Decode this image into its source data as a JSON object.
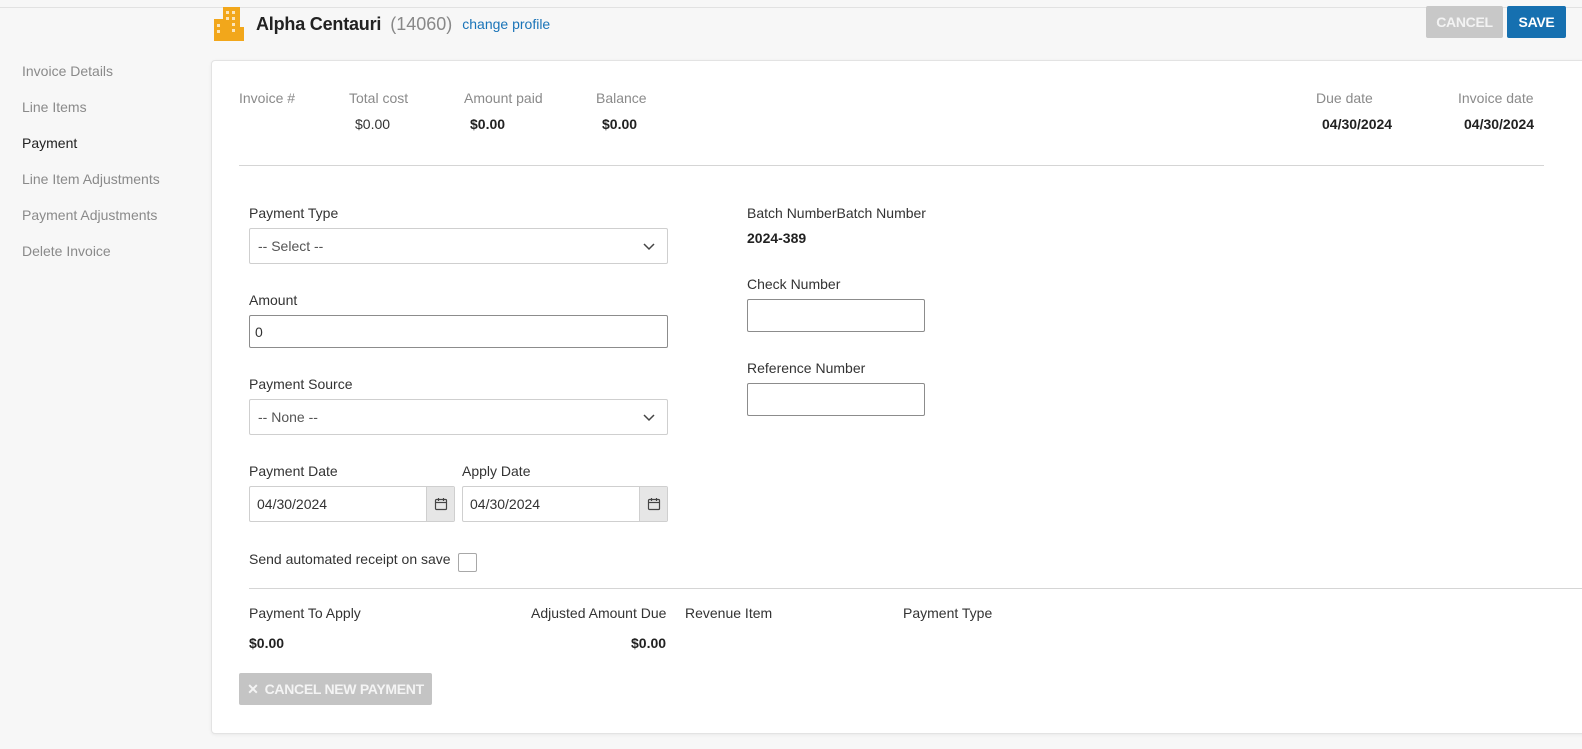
{
  "header": {
    "profile_name": "Alpha Centauri",
    "profile_id": "(14060)",
    "change_profile": "change profile",
    "cancel_label": "CANCEL",
    "save_label": "SAVE"
  },
  "sidebar": {
    "items": [
      {
        "label": "Invoice Details"
      },
      {
        "label": "Line Items"
      },
      {
        "label": "Payment"
      },
      {
        "label": "Line Item Adjustments"
      },
      {
        "label": "Payment Adjustments"
      },
      {
        "label": "Delete Invoice"
      }
    ],
    "active": "Payment"
  },
  "summary": {
    "invoice_label": "Invoice #",
    "invoice_value": "",
    "total_cost_label": "Total cost",
    "total_cost_value": "$0.00",
    "amount_paid_label": "Amount paid",
    "amount_paid_value": "$0.00",
    "balance_label": "Balance",
    "balance_value": "$0.00",
    "due_date_label": "Due date",
    "due_date_value": "04/30/2024",
    "invoice_date_label": "Invoice date",
    "invoice_date_value": "04/30/2024"
  },
  "form": {
    "payment_type_label": "Payment Type",
    "payment_type_value": "-- Select --",
    "amount_label": "Amount",
    "amount_value": "0",
    "payment_source_label": "Payment Source",
    "payment_source_value": "-- None --",
    "payment_date_label": "Payment Date",
    "payment_date_value": "04/30/2024",
    "apply_date_label": "Apply Date",
    "apply_date_value": "04/30/2024",
    "batch_label": "Batch NumberBatch Number",
    "batch_value": "2024-389",
    "check_label": "Check Number",
    "check_value": "",
    "reference_label": "Reference Number",
    "reference_value": "",
    "receipt_label": "Send automated receipt on save"
  },
  "apply": {
    "payment_to_apply_label": "Payment To Apply",
    "payment_to_apply_value": "$0.00",
    "adjusted_amount_label": "Adjusted Amount Due",
    "adjusted_amount_value": "$0.00",
    "revenue_item_label": "Revenue Item",
    "payment_type_label": "Payment Type",
    "cancel_new_payment": "CANCEL NEW PAYMENT"
  },
  "colors": {
    "accent": "#1670b0",
    "logo": "#f2a71b",
    "link": "#1a74b8"
  }
}
